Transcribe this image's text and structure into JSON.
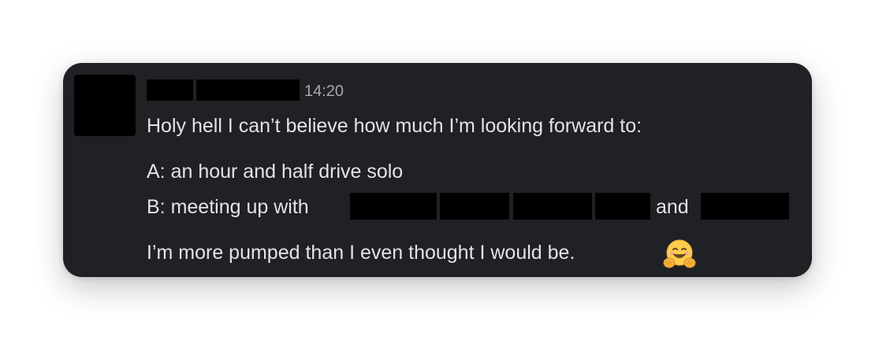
{
  "message": {
    "timestamp": "14:20",
    "line1": "Holy hell I can’t believe how much I’m looking forward to:",
    "line2": "A: an hour and half drive solo",
    "line3_prefix": "B: meeting up with",
    "line3_conjunction": "and",
    "line4": "I’m more pumped than I even thought I would be.",
    "emoji": "hugging-face-emoji"
  }
}
